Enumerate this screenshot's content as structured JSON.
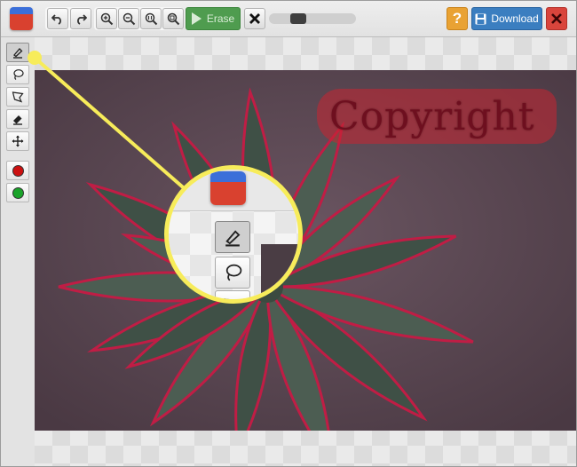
{
  "toolbar": {
    "erase_label": "Erase",
    "download_label": "Download",
    "help_label": "?",
    "brush_size_fraction": 0.3
  },
  "icons": {
    "app_logo": "app-logo-icon",
    "undo": "undo-icon",
    "redo": "redo-icon",
    "zoom_in": "zoom-in-icon",
    "zoom_out": "zoom-out-icon",
    "zoom_actual": "zoom-actual-size-icon",
    "zoom_fit": "zoom-fit-icon",
    "play": "play-icon",
    "clear": "x-icon",
    "save": "floppy-disk-icon",
    "close": "close-icon"
  },
  "tools": [
    {
      "name": "marker",
      "icon": "marker-icon",
      "active": true
    },
    {
      "name": "lasso",
      "icon": "lasso-icon",
      "active": false
    },
    {
      "name": "polygon-lasso",
      "icon": "polygon-lasso-icon",
      "active": false
    },
    {
      "name": "eraser",
      "icon": "eraser-icon",
      "active": false
    },
    {
      "name": "move",
      "icon": "move-icon",
      "active": false
    }
  ],
  "colors": {
    "remove_color": "#cc1111",
    "keep_color": "#1aa32a",
    "erase_button": "#4f9c4f",
    "download_button": "#3b7ec0",
    "help_button": "#e9a233",
    "close_button": "#d9453c",
    "callout": "#f7ec5a",
    "mask": "#c82432"
  },
  "canvas": {
    "watermark_text": "Copyright"
  }
}
